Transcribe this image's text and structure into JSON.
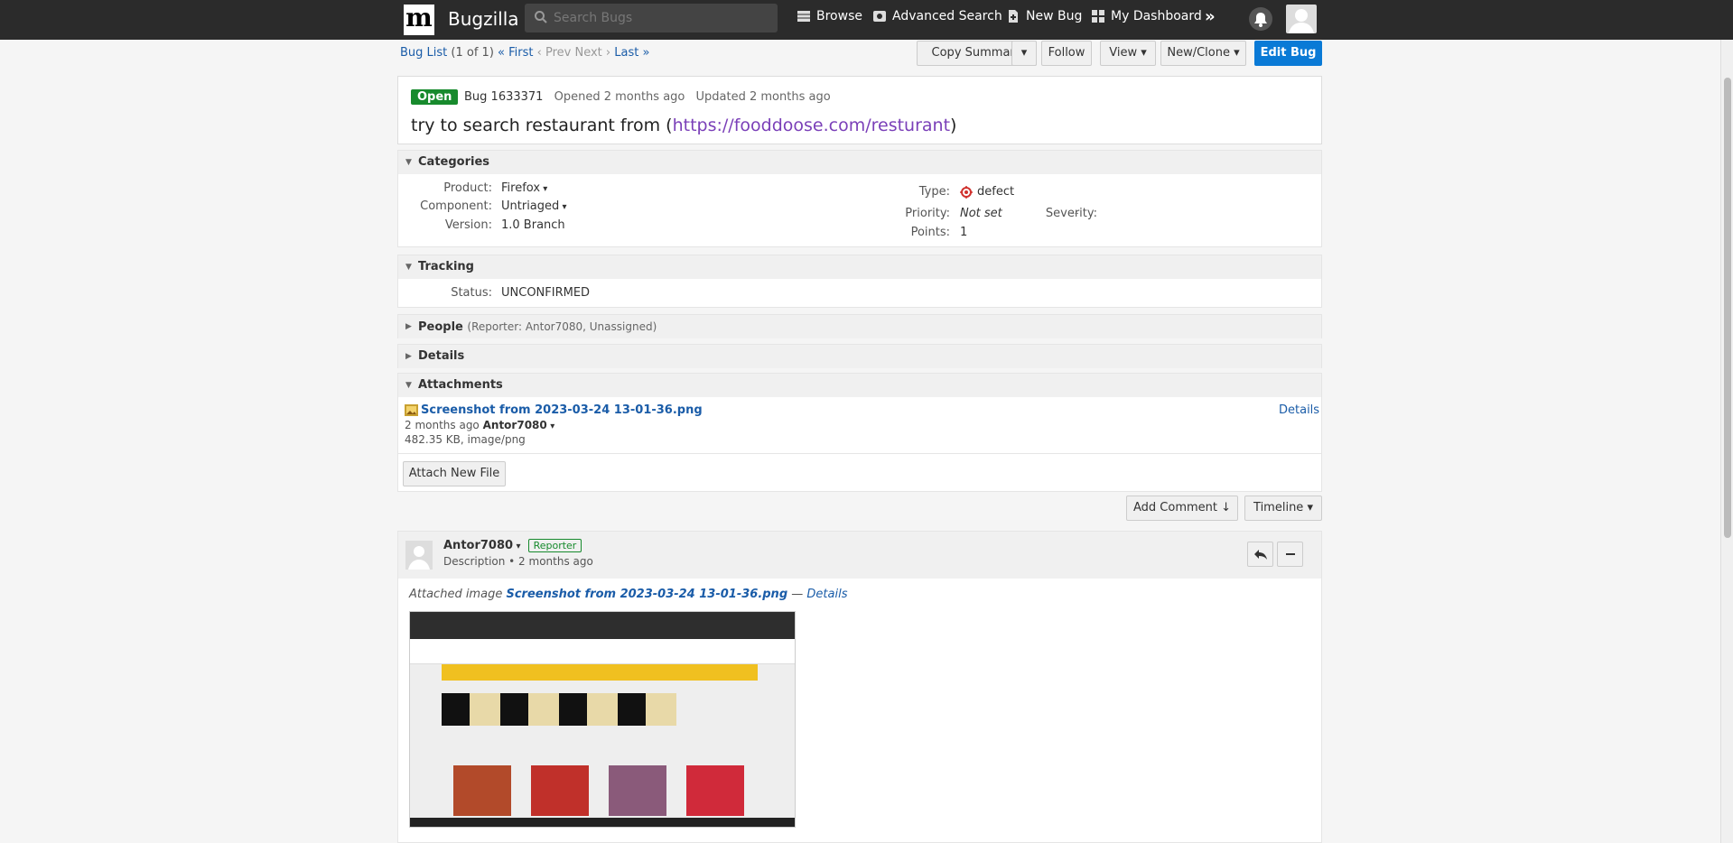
{
  "nav": {
    "brand": "Bugzilla",
    "logo_letter": "m",
    "search_placeholder": "Search Bugs",
    "browse": "Browse",
    "advanced_search": "Advanced Search",
    "new_bug": "New Bug",
    "dashboard": "My Dashboard",
    "more": "»"
  },
  "subnav": {
    "bug_list": "Bug List",
    "count": "(1 of 1)",
    "first": "« First",
    "prev": "‹ Prev",
    "next": "Next ›",
    "last": "Last »"
  },
  "actions": {
    "copy_summary": "Copy Summary",
    "follow": "Follow",
    "view": "View ▾",
    "new_clone": "New/Clone ▾",
    "edit_bug": "Edit Bug",
    "add_comment": "Add Comment ↓",
    "timeline": "Timeline ▾"
  },
  "bug": {
    "status_badge": "Open",
    "id": "Bug 1633371",
    "opened": "Opened 2 months ago",
    "updated": "Updated 2 months ago",
    "title_prefix": "try to search restaurant from (",
    "title_link": "https://fooddoose.com/resturant",
    "title_suffix": ")"
  },
  "categories": {
    "header": "Categories",
    "product_label": "Product:",
    "product": "Firefox",
    "component_label": "Component:",
    "component": "Untriaged",
    "version_label": "Version:",
    "version": "1.0 Branch",
    "type_label": "Type:",
    "type": "defect",
    "priority_label": "Priority:",
    "priority": "Not set",
    "severity_label": "Severity:",
    "severity": "--",
    "points_label": "Points:",
    "points": "1"
  },
  "tracking": {
    "header": "Tracking",
    "status_label": "Status:",
    "status": "UNCONFIRMED"
  },
  "people": {
    "header": "People",
    "summary": "(Reporter: Antor7080, Unassigned)"
  },
  "details": {
    "header": "Details"
  },
  "attachments": {
    "header": "Attachments",
    "file_name": "Screenshot from 2023-03-24 13-01-36.png",
    "details_link": "Details",
    "age": "2 months ago",
    "author": "Antor7080",
    "size": "482.35 KB, image/png",
    "attach_button": "Attach New File"
  },
  "comment": {
    "author": "Antor7080",
    "role": "Reporter",
    "meta": "Description • 2 months ago",
    "attached_prefix": "Attached image",
    "attached_file": "Screenshot from 2023-03-24 13-01-36.png",
    "attached_sep": "—",
    "attached_details": "Details"
  },
  "colors": {
    "topbar": "#2b2b2b",
    "primary": "#0a7ad6",
    "open_badge": "#178a2d",
    "link": "#1a5ca8",
    "visited_link": "#7a3fb8"
  }
}
